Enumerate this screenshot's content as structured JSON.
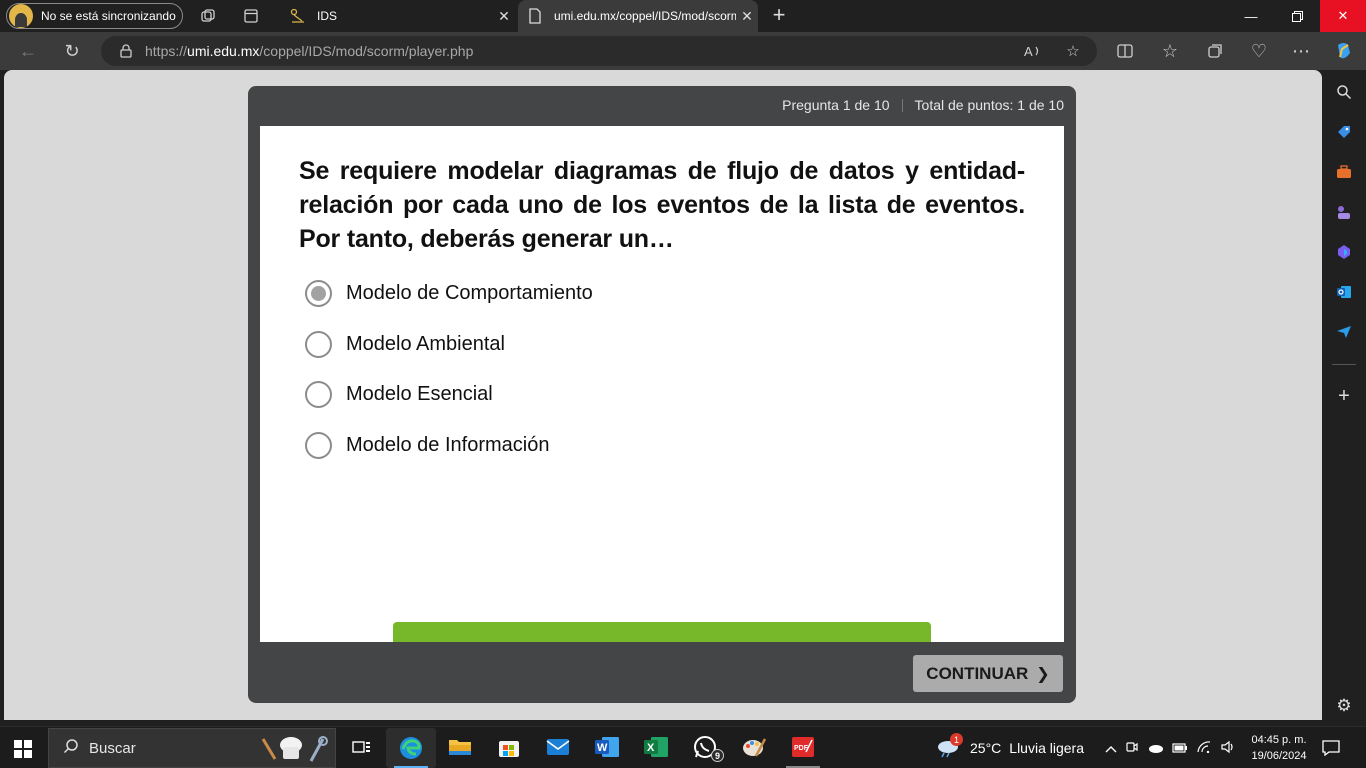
{
  "browser": {
    "profile_status": "No se está sincronizando",
    "tabs": [
      {
        "title": "IDS",
        "icon": "route-icon",
        "active": false
      },
      {
        "title": "umi.edu.mx/coppel/IDS/mod/scorm/player.php",
        "icon": "page-icon",
        "active": true
      }
    ],
    "address": {
      "scheme": "https://",
      "host": "umi.edu.mx",
      "path": "/coppel/IDS/mod/scorm/player.php"
    }
  },
  "quiz": {
    "question_counter": "Pregunta 1 de 10",
    "points": "Total de puntos: 1 de 10",
    "question": "Se requiere modelar diagramas de flujo de datos y entidad-relación por cada uno de los eventos de la lista de eventos. Por tanto, deberás generar un…",
    "options": [
      {
        "label": "Modelo de Comportamiento",
        "selected": true
      },
      {
        "label": "Modelo Ambiental",
        "selected": false
      },
      {
        "label": "Modelo Esencial",
        "selected": false
      },
      {
        "label": "Modelo de Información",
        "selected": false
      }
    ],
    "continue_label": "CONTINUAR",
    "accent_color": "#76b82a"
  },
  "taskbar": {
    "search_placeholder": "Buscar",
    "weather": {
      "temp": "25°C",
      "desc": "Lluvia ligera",
      "alert_count": "1"
    },
    "whatsapp_badge": "9",
    "clock": {
      "time": "04:45 p. m.",
      "date": "19/06/2024"
    }
  }
}
